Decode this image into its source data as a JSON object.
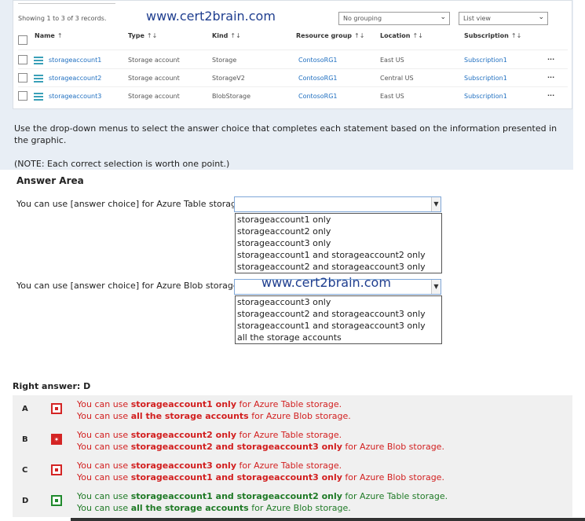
{
  "watermark": "www.cert2brain.com",
  "azure_grid": {
    "records": "Showing 1 to 3 of 3 records.",
    "grouping": "No grouping",
    "view": "List view",
    "columns": [
      "Name",
      "Type",
      "Kind",
      "Resource group",
      "Location",
      "Subscription"
    ],
    "sort_glyph": "↑↓",
    "name_sort_glyph": "↑",
    "rows": [
      {
        "name": "storageaccount1",
        "type": "Storage account",
        "kind": "Storage",
        "resource_group": "ContosoRG1",
        "location": "East US",
        "subscription": "Subscription1"
      },
      {
        "name": "storageaccount2",
        "type": "Storage account",
        "kind": "StorageV2",
        "resource_group": "ContosoRG1",
        "location": "Central US",
        "subscription": "Subscription1"
      },
      {
        "name": "storageaccount3",
        "type": "Storage account",
        "kind": "BlobStorage",
        "resource_group": "ContosoRG1",
        "location": "East US",
        "subscription": "Subscription1"
      }
    ],
    "more_glyph": "···"
  },
  "question": {
    "instructions": "Use the drop-down menus to select the answer choice that completes each statement based on the information presented in the graphic.",
    "note": "(NOTE: Each correct selection is worth one point.)"
  },
  "answer_area": {
    "title": "Answer Area",
    "statement_1": "You can use [answer choice] for Azure Table storage.",
    "statement_2": "You can use [answer choice] for Azure Blob storage.",
    "dropdown_1_options": [
      "storageaccount1 only",
      "storageaccount2 only",
      "storageaccount3 only",
      "storageaccount1 and storageaccount2 only",
      "storageaccount2 and storageaccount3 only"
    ],
    "dropdown_2_options": [
      "storageaccount3 only",
      "storageaccount2 and storageaccount3 only",
      "storageaccount1 and storageaccount3 only",
      "all the storage accounts"
    ],
    "arrow_glyph": "▼"
  },
  "result": {
    "right_answer": "Right answer: D",
    "choices": [
      {
        "letter": "A",
        "line1_pre": "You can use ",
        "line1_bold": "storageaccount1 only",
        "line1_post": " for Azure Table storage.",
        "line2_pre": "You can use ",
        "line2_bold": "all the storage accounts",
        "line2_post": " for Azure Blob storage.",
        "state": "wrong"
      },
      {
        "letter": "B",
        "line1_pre": "You can use ",
        "line1_bold": "storageaccount2 only",
        "line1_post": " for Azure Table storage.",
        "line2_pre": "You can use ",
        "line2_bold": "storageaccount2 and storageaccount3 only",
        "line2_post": " for Azure Blob storage.",
        "state": "selected-wrong"
      },
      {
        "letter": "C",
        "line1_pre": "You can use ",
        "line1_bold": "storageaccount3 only",
        "line1_post": " for Azure Table storage.",
        "line2_pre": "You can use ",
        "line2_bold": "storageaccount1 and storageaccount3 only",
        "line2_post": " for Azure Blob storage.",
        "state": "wrong"
      },
      {
        "letter": "D",
        "line1_pre": "You can use ",
        "line1_bold": "storageaccount1 and storageaccount2 only",
        "line1_post": " for Azure Table storage.",
        "line2_pre": "You can use ",
        "line2_bold": "all the storage accounts",
        "line2_post": " for Azure Blob storage.",
        "state": "correct"
      }
    ]
  },
  "colors": {
    "wrong": "#d21f1f",
    "correct": "#1f7a26",
    "link": "#1f6fc0",
    "panel": "#e8eef5"
  }
}
